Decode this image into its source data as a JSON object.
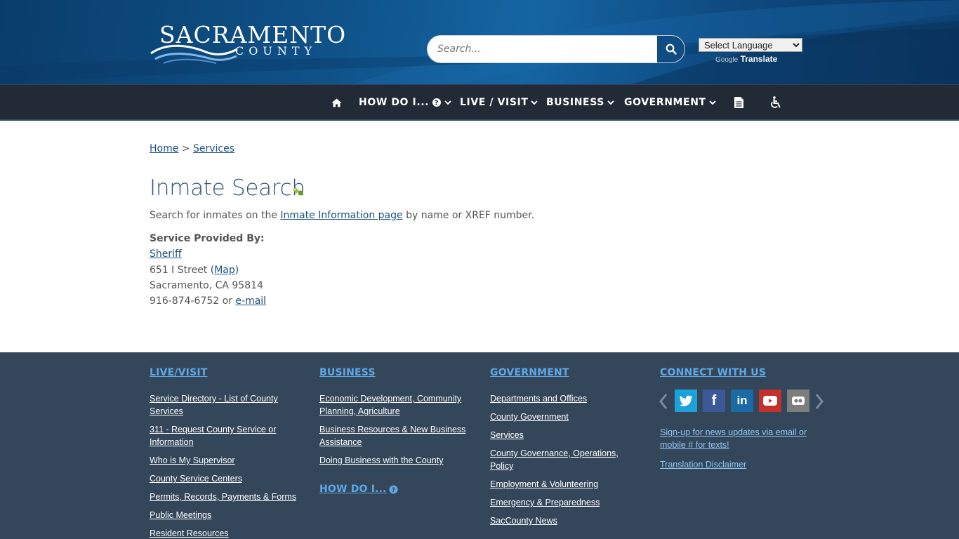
{
  "header": {
    "logo_line1": "SACRAMENTO",
    "logo_line2": "COUNTY",
    "search_placeholder": "Search...",
    "search_icon": "search-icon",
    "language_select": "Select Language",
    "powered_google": "Google",
    "powered_translate": "Translate"
  },
  "nav": {
    "home_icon": "home-icon",
    "how_do_i": "HOW DO I...",
    "live_visit": "LIVE / VISIT",
    "business": "BUSINESS",
    "government": "GOVERNMENT",
    "document_icon": "document-icon",
    "accessibility_icon": "accessibility-icon"
  },
  "breadcrumb": {
    "home": "Home",
    "separator": ">",
    "services": "Services"
  },
  "main": {
    "title": "Inmate Search",
    "desc_before": "Search for inmates on the ",
    "desc_link": "Inmate Information page",
    "desc_after": " by name or XREF number.",
    "provided_by": "Service Provided By:",
    "provider": "Sheriff",
    "street": "651 I Street ",
    "map_open": "(",
    "map_link": "Map",
    "map_close": ")",
    "city": "Sacramento, CA 95814",
    "phone": "916-874-6752 or ",
    "email_link": "e-mail"
  },
  "footer": {
    "live_visit": {
      "heading": "LIVE/VISIT",
      "links": [
        "Service Directory - List of County Services",
        "311 - Request County Service or Information",
        "Who is My Supervisor",
        "County Service Centers",
        "Permits, Records, Payments & Forms",
        "Public Meetings",
        "Resident Resources"
      ]
    },
    "business": {
      "heading": "BUSINESS",
      "links": [
        "Economic Development, Community Planning, Agriculture",
        "Business Resources & New Business Assistance",
        "Doing Business with the County"
      ],
      "how_do_i": "HOW DO I..."
    },
    "government": {
      "heading": "GOVERNMENT",
      "links": [
        "Departments and Offices",
        "County Government",
        "Services",
        "County Governance, Operations, Policy",
        "Employment & Volunteering",
        "Emergency & Preparedness",
        "SacCounty News"
      ]
    },
    "connect": {
      "heading": "CONNECT WITH US",
      "social": [
        "twitter-icon",
        "facebook-icon",
        "linkedin-icon",
        "youtube-icon",
        "flickr-icon"
      ],
      "signup": "Sign-up for news updates via email or mobile # for texts!",
      "disclaimer": "Translation Disclaimer"
    }
  },
  "colors": {
    "header_blue": "#0f5289",
    "nav_dark": "#222a35",
    "footer_bg": "#34465a",
    "footer_heading": "#5fa8e6",
    "link": "#1c4f7f",
    "twitter": "#1da1d9",
    "facebook": "#3b5998",
    "linkedin": "#1b6aa6",
    "youtube": "#c4302b",
    "flickr": "#7d7d7d"
  }
}
